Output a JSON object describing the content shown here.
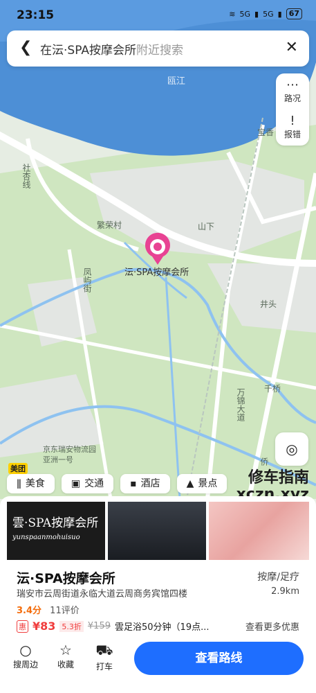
{
  "status": {
    "time": "23:15",
    "signal": "5G",
    "battery": "67"
  },
  "search": {
    "query": "在沄·SPA按摩会所",
    "placeholder": "附近搜索"
  },
  "float_buttons": [
    {
      "label": "路况",
      "icon": "traffic-icon"
    },
    {
      "label": "报错",
      "icon": "report-icon"
    }
  ],
  "map_labels": {
    "river": "瓯江",
    "line": "社杏线",
    "village1": "繁荣村",
    "village2": "山下",
    "poi": "沄·SPA按摩会所",
    "road1": "凤屿街",
    "place1": "井头",
    "place2": "千桥",
    "road2": "万锦大道",
    "road3": "侨",
    "place3": "宝香",
    "logistics": "京东瑞安物流园",
    "logistics2": "亚洲一号",
    "brand": "美团"
  },
  "categories": [
    {
      "label": "美食",
      "icon": "food-icon"
    },
    {
      "label": "交通",
      "icon": "bus-icon"
    },
    {
      "label": "酒店",
      "icon": "hotel-icon"
    },
    {
      "label": "景点",
      "icon": "scenic-icon"
    }
  ],
  "watermark": {
    "line1": "修车指南",
    "line2": "xczn.xyz"
  },
  "poi_card": {
    "photo_text": "雲·SPA按摩会所",
    "photo_sub": "yunspaanmohuisuo",
    "title": "沄·SPA按摩会所",
    "category": "按摩/足疗",
    "address": "瑞安市云周街道永临大道云周商务宾馆四楼",
    "distance": "2.9km",
    "rating": "3.4分",
    "reviews": "11评价",
    "deal_badge": "惠",
    "deal_price": "¥83",
    "deal_discount": "5.3折",
    "deal_original": "¥159",
    "deal_name": "雲足浴50分钟（19点...",
    "more_deals": "查看更多优惠"
  },
  "bottom_nav": [
    {
      "label": "搜周边",
      "icon": "search-icon"
    },
    {
      "label": "收藏",
      "icon": "star-icon"
    },
    {
      "label": "打车",
      "icon": "car-icon"
    }
  ],
  "route_button": "查看路线"
}
